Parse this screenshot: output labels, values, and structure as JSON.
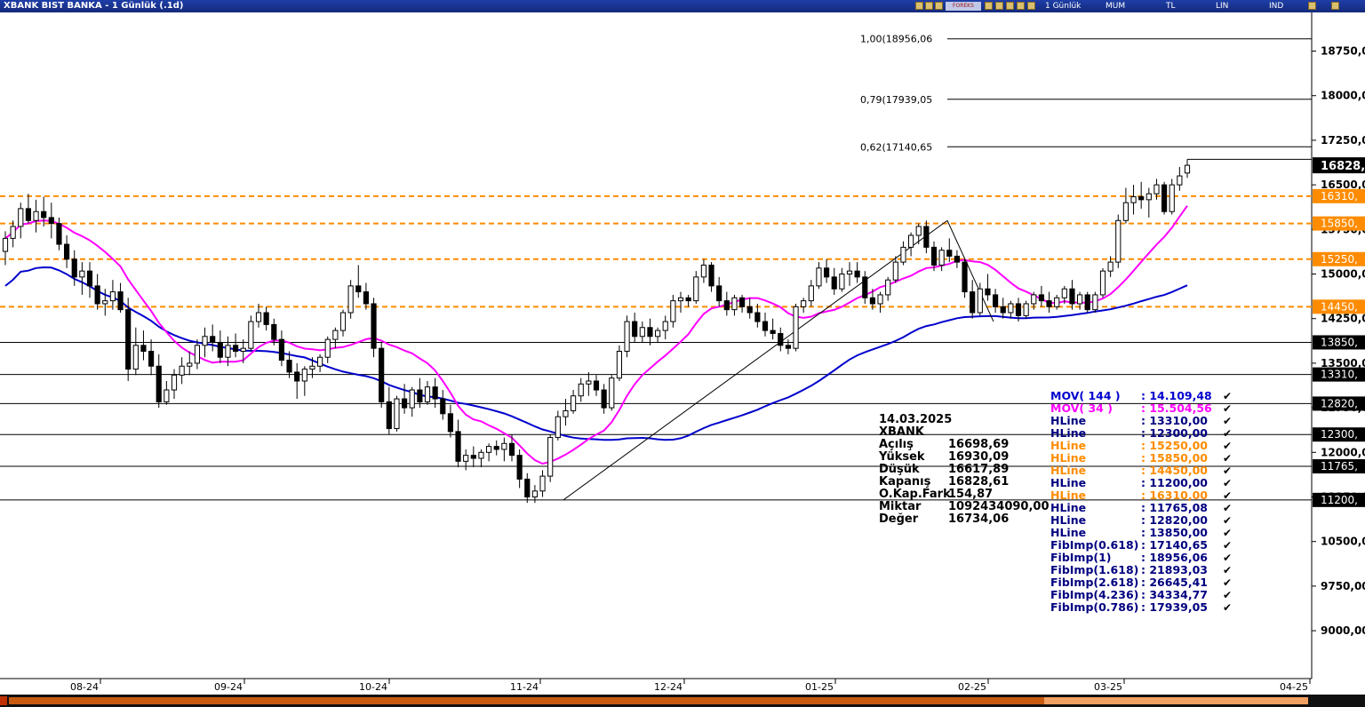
{
  "window": {
    "title": "XBANK BIST BANKA - 1 Günlük (.1d)"
  },
  "toolbar": {
    "brand_logo_text": "FOREKS",
    "period_label": "1 Günlük",
    "chart_type_label": "MUM",
    "currency_label": "TL",
    "scale_label": "LIN",
    "indicator_label": "IND",
    "icons": [
      "settings-icon",
      "back-icon",
      "forward-icon",
      "grid-icon",
      "draw-icon",
      "zoom-icon",
      "refresh-icon",
      "cursor-icon",
      "minimize-icon",
      "close-icon"
    ]
  },
  "chart_data": {
    "type": "candlestick",
    "symbol": "XBANK",
    "x_ticks": [
      "08-24",
      "09-24",
      "10-24",
      "11-24",
      "12-24",
      "01-25",
      "02-25",
      "03-25",
      "04-25"
    ],
    "y_ticks": [
      "18750,00",
      "18000,00",
      "17250,00",
      "16500,00",
      "15750,00",
      "15000,00",
      "14250,00",
      "13500,00",
      "12750,00",
      "12000,00",
      "11250,00",
      "10500,00",
      "9750,00",
      "9000,00"
    ],
    "y_range": [
      8700,
      19400
    ],
    "last_price_label": "16828,",
    "hlines": [
      {
        "label": "16310,",
        "value": 16310,
        "color": "#ff8c00",
        "style": "dashed"
      },
      {
        "label": "15850,",
        "value": 15850,
        "color": "#ff8c00",
        "style": "dashed"
      },
      {
        "label": "15250,",
        "value": 15250,
        "color": "#ff8c00",
        "style": "dashed"
      },
      {
        "label": "14450,",
        "value": 14450,
        "color": "#ff8c00",
        "style": "dashed"
      },
      {
        "label": "13850,",
        "value": 13850,
        "color": "#000000",
        "style": "solid"
      },
      {
        "label": "13310,",
        "value": 13310,
        "color": "#000000",
        "style": "solid"
      },
      {
        "label": "12820,",
        "value": 12820,
        "color": "#000000",
        "style": "solid"
      },
      {
        "label": "12300,",
        "value": 12300,
        "color": "#000000",
        "style": "solid"
      },
      {
        "label": "11765,",
        "value": 11765,
        "color": "#000000",
        "style": "solid"
      },
      {
        "label": "11200,",
        "value": 11200,
        "color": "#000000",
        "style": "solid"
      }
    ],
    "fib_lines": [
      {
        "label": "1,00(18956,06",
        "value": 18956
      },
      {
        "label": "0,79(17939,05",
        "value": 17939
      },
      {
        "label": "0,62(17140,65",
        "value": 17140
      }
    ],
    "candles": [
      [
        15380,
        15720,
        15150,
        15600
      ],
      [
        15600,
        15900,
        15450,
        15800
      ],
      [
        15800,
        16200,
        15600,
        16100
      ],
      [
        16100,
        16350,
        15850,
        15900
      ],
      [
        15900,
        16250,
        15700,
        16050
      ],
      [
        16050,
        16300,
        15800,
        15950
      ],
      [
        15950,
        16200,
        15600,
        15850
      ],
      [
        15850,
        15950,
        15400,
        15500
      ],
      [
        15500,
        15650,
        15100,
        15250
      ],
      [
        15250,
        15400,
        14800,
        14950
      ],
      [
        14950,
        15200,
        14650,
        15050
      ],
      [
        15050,
        15200,
        14600,
        14800
      ],
      [
        14800,
        15000,
        14400,
        14500
      ],
      [
        14500,
        14750,
        14300,
        14550
      ],
      [
        14550,
        14900,
        14400,
        14700
      ],
      [
        14700,
        14850,
        14350,
        14400
      ],
      [
        14400,
        14600,
        13200,
        13400
      ],
      [
        13400,
        14100,
        13300,
        13800
      ],
      [
        13800,
        14050,
        13550,
        13700
      ],
      [
        13700,
        13900,
        13300,
        13450
      ],
      [
        13450,
        13650,
        12750,
        12850
      ],
      [
        12850,
        13200,
        12800,
        13050
      ],
      [
        13050,
        13400,
        12900,
        13300
      ],
      [
        13300,
        13600,
        13150,
        13450
      ],
      [
        13450,
        13700,
        13300,
        13500
      ],
      [
        13500,
        13900,
        13400,
        13800
      ],
      [
        13800,
        14100,
        13600,
        13950
      ],
      [
        13950,
        14150,
        13700,
        13850
      ],
      [
        13850,
        14050,
        13500,
        13600
      ],
      [
        13600,
        13950,
        13450,
        13800
      ],
      [
        13800,
        14000,
        13600,
        13700
      ],
      [
        13700,
        13900,
        13500,
        13750
      ],
      [
        13750,
        14300,
        13700,
        14200
      ],
      [
        14200,
        14500,
        14100,
        14350
      ],
      [
        14350,
        14450,
        14050,
        14150
      ],
      [
        14150,
        14250,
        13800,
        13900
      ],
      [
        13900,
        14050,
        13450,
        13550
      ],
      [
        13550,
        13700,
        13250,
        13350
      ],
      [
        13350,
        13500,
        12900,
        13200
      ],
      [
        13200,
        13450,
        12950,
        13400
      ],
      [
        13400,
        13600,
        13250,
        13450
      ],
      [
        13450,
        13650,
        13350,
        13600
      ],
      [
        13600,
        13950,
        13500,
        13900
      ],
      [
        13900,
        14100,
        13750,
        14050
      ],
      [
        14050,
        14400,
        13950,
        14350
      ],
      [
        14350,
        14900,
        14250,
        14800
      ],
      [
        14800,
        15150,
        14600,
        14700
      ],
      [
        14700,
        14850,
        14400,
        14500
      ],
      [
        14500,
        14600,
        13600,
        13750
      ],
      [
        13750,
        13850,
        12750,
        12850
      ],
      [
        12850,
        13100,
        12300,
        12400
      ],
      [
        12400,
        12950,
        12350,
        12900
      ],
      [
        12900,
        13150,
        12650,
        12750
      ],
      [
        12750,
        13100,
        12600,
        13050
      ],
      [
        13050,
        13250,
        12750,
        12850
      ],
      [
        12850,
        13200,
        12800,
        13100
      ],
      [
        13100,
        13250,
        12750,
        12900
      ],
      [
        12900,
        13050,
        12550,
        12650
      ],
      [
        12650,
        12800,
        12250,
        12350
      ],
      [
        12350,
        12550,
        11750,
        11850
      ],
      [
        11850,
        12050,
        11700,
        11950
      ],
      [
        11950,
        12100,
        11750,
        11900
      ],
      [
        11900,
        12050,
        11750,
        12000
      ],
      [
        12000,
        12150,
        11850,
        12100
      ],
      [
        12100,
        12200,
        11950,
        12050
      ],
      [
        12050,
        12250,
        11850,
        12150
      ],
      [
        12150,
        12300,
        11850,
        11950
      ],
      [
        11950,
        12050,
        11400,
        11550
      ],
      [
        11550,
        11650,
        11150,
        11250
      ],
      [
        11250,
        11450,
        11150,
        11350
      ],
      [
        11350,
        11700,
        11250,
        11600
      ],
      [
        11600,
        12300,
        11500,
        12250
      ],
      [
        12250,
        12700,
        12200,
        12600
      ],
      [
        12600,
        12900,
        12450,
        12700
      ],
      [
        12700,
        13050,
        12650,
        12950
      ],
      [
        12950,
        13250,
        12850,
        13150
      ],
      [
        13150,
        13350,
        12950,
        13200
      ],
      [
        13200,
        13300,
        12950,
        13050
      ],
      [
        13050,
        13150,
        12650,
        12750
      ],
      [
        12750,
        13300,
        12700,
        13250
      ],
      [
        13250,
        13800,
        13200,
        13700
      ],
      [
        13700,
        14300,
        13600,
        14200
      ],
      [
        14200,
        14350,
        13850,
        13950
      ],
      [
        13950,
        14200,
        13850,
        14100
      ],
      [
        14100,
        14250,
        13800,
        13950
      ],
      [
        13950,
        14100,
        13850,
        14050
      ],
      [
        14050,
        14300,
        13900,
        14200
      ],
      [
        14200,
        14650,
        14100,
        14550
      ],
      [
        14550,
        14700,
        14350,
        14600
      ],
      [
        14600,
        14650,
        14450,
        14550
      ],
      [
        14550,
        15050,
        14500,
        14950
      ],
      [
        14950,
        15250,
        14850,
        15150
      ],
      [
        15150,
        15200,
        14700,
        14800
      ],
      [
        14800,
        14950,
        14450,
        14550
      ],
      [
        14550,
        14700,
        14300,
        14400
      ],
      [
        14400,
        14650,
        14300,
        14600
      ],
      [
        14600,
        14650,
        14350,
        14450
      ],
      [
        14450,
        14600,
        14250,
        14350
      ],
      [
        14350,
        14500,
        14100,
        14200
      ],
      [
        14200,
        14350,
        13950,
        14050
      ],
      [
        14050,
        14250,
        13900,
        14000
      ],
      [
        14000,
        14100,
        13700,
        13800
      ],
      [
        13800,
        13900,
        13650,
        13750
      ],
      [
        13750,
        14500,
        13700,
        14450
      ],
      [
        14450,
        14600,
        14350,
        14550
      ],
      [
        14550,
        14900,
        14450,
        14800
      ],
      [
        14800,
        15200,
        14750,
        15100
      ],
      [
        15100,
        15250,
        14850,
        14950
      ],
      [
        14950,
        15100,
        14650,
        14750
      ],
      [
        14750,
        15100,
        14700,
        15000
      ],
      [
        15000,
        15200,
        14800,
        15050
      ],
      [
        15050,
        15200,
        14850,
        14950
      ],
      [
        14950,
        15050,
        14500,
        14600
      ],
      [
        14600,
        14750,
        14400,
        14500
      ],
      [
        14500,
        14700,
        14350,
        14650
      ],
      [
        14650,
        14950,
        14550,
        14900
      ],
      [
        14900,
        15300,
        14850,
        15200
      ],
      [
        15200,
        15550,
        15150,
        15450
      ],
      [
        15450,
        15700,
        15300,
        15650
      ],
      [
        15650,
        15850,
        15500,
        15800
      ],
      [
        15800,
        15900,
        15350,
        15450
      ],
      [
        15450,
        15550,
        15050,
        15150
      ],
      [
        15150,
        15450,
        15050,
        15400
      ],
      [
        15400,
        15600,
        15200,
        15300
      ],
      [
        15300,
        15400,
        15100,
        15200
      ],
      [
        15200,
        15250,
        14600,
        14700
      ],
      [
        14700,
        14900,
        14250,
        14350
      ],
      [
        14350,
        14850,
        14300,
        14750
      ],
      [
        14750,
        15000,
        14550,
        14650
      ],
      [
        14650,
        14750,
        14350,
        14450
      ],
      [
        14450,
        14600,
        14250,
        14350
      ],
      [
        14350,
        14550,
        14250,
        14500
      ],
      [
        14500,
        14600,
        14200,
        14300
      ],
      [
        14300,
        14550,
        14250,
        14500
      ],
      [
        14500,
        14700,
        14400,
        14650
      ],
      [
        14650,
        14800,
        14450,
        14550
      ],
      [
        14550,
        14700,
        14350,
        14450
      ],
      [
        14450,
        14650,
        14400,
        14600
      ],
      [
        14600,
        14800,
        14500,
        14750
      ],
      [
        14750,
        14900,
        14400,
        14500
      ],
      [
        14500,
        14700,
        14400,
        14650
      ],
      [
        14650,
        14700,
        14350,
        14400
      ],
      [
        14400,
        14700,
        14350,
        14650
      ],
      [
        14650,
        15100,
        14600,
        15050
      ],
      [
        15050,
        15300,
        14950,
        15200
      ],
      [
        15200,
        16000,
        15100,
        15900
      ],
      [
        15900,
        16450,
        15850,
        16200
      ],
      [
        16200,
        16500,
        16000,
        16300
      ],
      [
        16300,
        16550,
        16100,
        16250
      ],
      [
        16250,
        16450,
        15950,
        16350
      ],
      [
        16350,
        16600,
        16250,
        16500
      ],
      [
        16500,
        16550,
        16000,
        16050
      ],
      [
        16050,
        16600,
        16000,
        16500
      ],
      [
        16500,
        16800,
        16400,
        16650
      ],
      [
        16698.69,
        16930.09,
        16617.89,
        16828.61
      ]
    ],
    "ma144": {
      "label": "MOV( 144 )",
      "value": "14.109,48",
      "color": "#0000cc"
    },
    "ma34": {
      "label": "MOV( 34 )",
      "value": "15.504,56",
      "color": "#ff00ff"
    }
  },
  "ohlc_box": {
    "date": "14.03.2025",
    "symbol": "XBANK",
    "rows": [
      {
        "label": "Açılış",
        "value": "16698,69"
      },
      {
        "label": "Yüksek",
        "value": "16930,09"
      },
      {
        "label": "Düşük",
        "value": "16617,89"
      },
      {
        "label": "Kapanış",
        "value": "16828,61"
      },
      {
        "label": "O.Kap.Fark",
        "value": "154,87"
      },
      {
        "label": "Miktar",
        "value": "1092434090,00"
      },
      {
        "label": "Değer",
        "value": "16734,06"
      }
    ]
  },
  "legend": [
    {
      "name": "MOV( 144 )",
      "value": ": 14.109,48",
      "color": "#0000cc"
    },
    {
      "name": "MOV( 34 )",
      "value": ": 15.504,56",
      "color": "#ff00ff"
    },
    {
      "name": "HLine",
      "value": ": 13310,00",
      "color": "#000080"
    },
    {
      "name": "HLine",
      "value": ": 12300,00",
      "color": "#000080"
    },
    {
      "name": "HLine",
      "value": ": 15250,00",
      "color": "#ff8c00"
    },
    {
      "name": "HLine",
      "value": ": 15850,00",
      "color": "#ff8c00"
    },
    {
      "name": "HLine",
      "value": ": 14450,00",
      "color": "#ff8c00"
    },
    {
      "name": "HLine",
      "value": ": 11200,00",
      "color": "#000080"
    },
    {
      "name": "HLine",
      "value": ": 16310,00",
      "color": "#ff8c00"
    },
    {
      "name": "HLine",
      "value": ": 11765,08",
      "color": "#000080"
    },
    {
      "name": "HLine",
      "value": ": 12820,00",
      "color": "#000080"
    },
    {
      "name": "HLine",
      "value": ": 13850,00",
      "color": "#000080"
    },
    {
      "name": "FibImp(0.618)",
      "value": ": 17140,65",
      "color": "#000080"
    },
    {
      "name": "FibImp(1)",
      "value": ": 18956,06",
      "color": "#000080"
    },
    {
      "name": "FibImp(1.618)",
      "value": ": 21893,03",
      "color": "#000080"
    },
    {
      "name": "FibImp(2.618)",
      "value": ": 26645,41",
      "color": "#000080"
    },
    {
      "name": "FibImp(4.236)",
      "value": ": 34334,77",
      "color": "#000080"
    },
    {
      "name": "FibImp(0.786)",
      "value": ": 17939,05",
      "color": "#000080"
    }
  ]
}
